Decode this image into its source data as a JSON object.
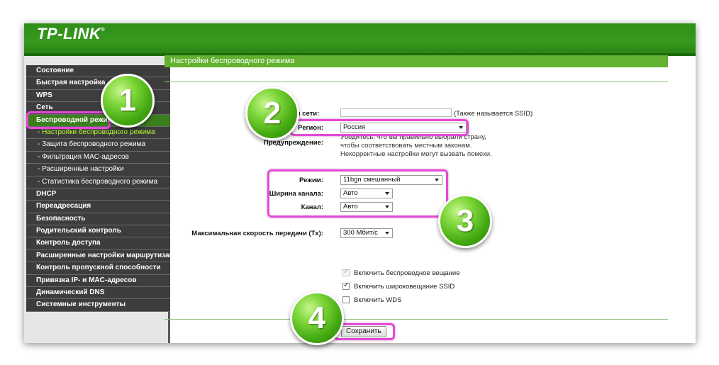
{
  "header": {
    "logo": "TP-LINK",
    "logo_mark": "®"
  },
  "sidebar": {
    "items": [
      {
        "label": "Состояние"
      },
      {
        "label": "Быстрая настройка"
      },
      {
        "label": "WPS"
      },
      {
        "label": "Сеть"
      },
      {
        "label": "Беспроводной режим"
      },
      {
        "label": "- Настройки беспроводного режима"
      },
      {
        "label": "- Защита беспроводного режима"
      },
      {
        "label": "- Фильтрация MAC-адресов"
      },
      {
        "label": "- Расширенные настройки"
      },
      {
        "label": "- Статистика беспроводного режима"
      },
      {
        "label": "DHCP"
      },
      {
        "label": "Переадресация"
      },
      {
        "label": "Безопасность"
      },
      {
        "label": "Родительский контроль"
      },
      {
        "label": "Контроль доступа"
      },
      {
        "label": "Расширенные настройки маршрутизации"
      },
      {
        "label": "Контроль пропускной способности"
      },
      {
        "label": "Привязка IP- и MAC-адресов"
      },
      {
        "label": "Динамический DNS"
      },
      {
        "label": "Системные инструменты"
      }
    ]
  },
  "main": {
    "title": "Настройки беспроводного режима",
    "ssid_label": "я сети:",
    "ssid_hint": "(Также называется SSID)",
    "region_label": "Регион:",
    "region_value": "Россия",
    "warning_label": "Предупреждение:",
    "warning_lines": [
      "Убедитесь, что вы правильно выбрали страну,",
      "чтобы соответствовать местным законам.",
      "Некорректные настройки могут вызвать помехи."
    ],
    "mode_label": "Режим:",
    "mode_value": "11bgn смешанный",
    "width_label": "Ширина канала:",
    "width_value": "Авто",
    "channel_label": "Канал:",
    "channel_value": "Авто",
    "speed_label": "Максимальная скорость передачи (Tx):",
    "speed_value": "300 Мбит/с",
    "checkbox_broadcast": "Включить беспроводное вещание",
    "checkbox_ssid": "Включить широковещание SSID",
    "checkbox_wds": "Включить WDS",
    "save_button": "Сохранить"
  },
  "callouts": [
    "1",
    "2",
    "3",
    "4"
  ],
  "colors": {
    "header_green": "#37991e",
    "highlight": "#e24ad6",
    "menu_dark": "#3d3d3d",
    "title_green": "#62b12f"
  }
}
